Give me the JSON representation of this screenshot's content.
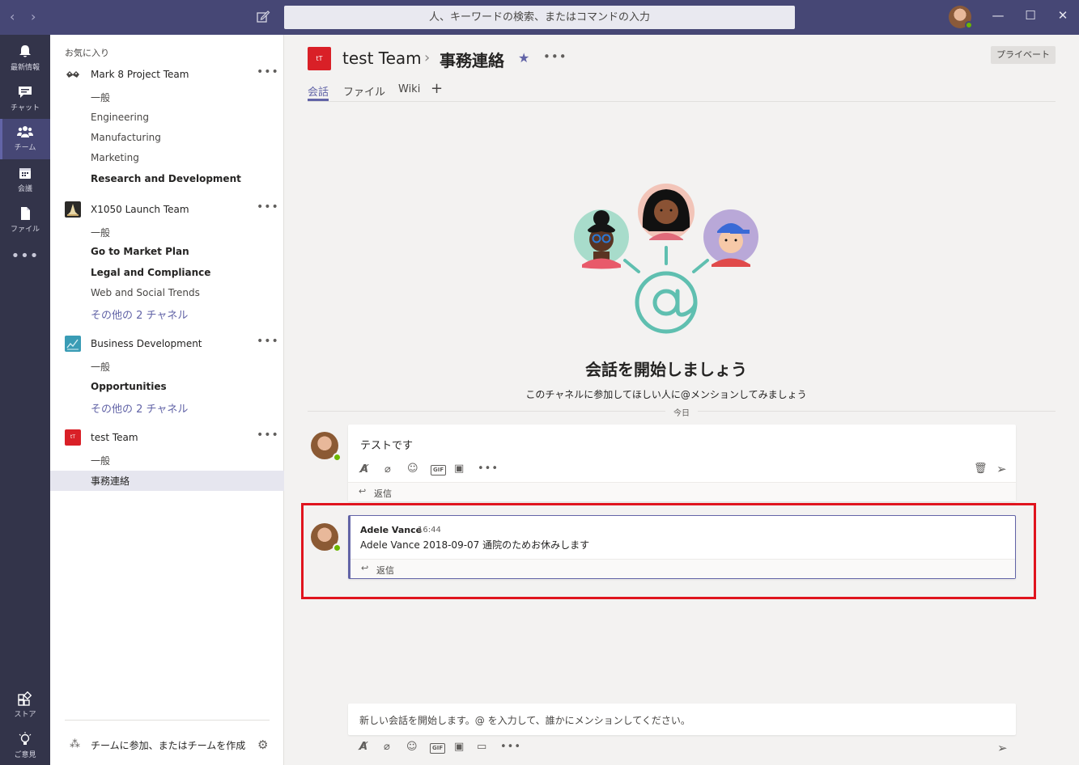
{
  "search": {
    "placeholder": "人、キーワードの検索、またはコマンドの入力"
  },
  "window": {
    "back": "‹",
    "forward": "›",
    "minimize": "—",
    "maximize": "☐",
    "close": "✕"
  },
  "rail": {
    "items": [
      {
        "label": "最新情報",
        "icon": "bell-icon"
      },
      {
        "label": "チャット",
        "icon": "chat-icon"
      },
      {
        "label": "チーム",
        "icon": "teams-icon"
      },
      {
        "label": "会議",
        "icon": "calendar-icon"
      },
      {
        "label": "ファイル",
        "icon": "file-icon"
      }
    ],
    "more": "•••",
    "store": "ストア",
    "feedback": "ご意見"
  },
  "teams_panel": {
    "favorites_label": "お気に入り",
    "teams": [
      {
        "name": "Mark 8 Project Team",
        "icon_text": "",
        "channels": [
          "一般",
          "Engineering",
          "Manufacturing",
          "Marketing",
          "Research and Development"
        ]
      },
      {
        "name": "X1050 Launch Team",
        "icon_text": "",
        "channels": [
          "一般",
          "Go to Market Plan",
          "Legal and Compliance",
          "Web and Social Trends"
        ],
        "more_channels": "その他の 2 チャネル"
      },
      {
        "name": "Business Development",
        "icon_text": "",
        "channels": [
          "一般",
          "Opportunities"
        ],
        "more_channels": "その他の 2 チャネル"
      },
      {
        "name": "test Team",
        "icon_text": "tT",
        "channels": [
          "一般",
          "事務連絡"
        ]
      }
    ],
    "more_glyph": "•••",
    "join_label": "チームに参加、またはチームを作成"
  },
  "channel_header": {
    "team_icon_text": "tT",
    "team_name": "test Team",
    "separator": "›",
    "channel_name": "事務連絡",
    "private_badge": "プライベート",
    "more_glyph": "•••",
    "tabs": [
      "会話",
      "ファイル",
      "Wiki"
    ],
    "add_tab": "+"
  },
  "empty_state": {
    "title": "会話を開始しましょう",
    "subtitle": "このチャネルに参加してほしい人に@メンションしてみましょう"
  },
  "date_divider": "今日",
  "messages": [
    {
      "author": "",
      "time": "",
      "text": "テストです",
      "reply_label": "返信"
    },
    {
      "author": "Adele Vance",
      "time": "16:44",
      "text": "Adele Vance 2018-09-07  通院のためお休みします",
      "reply_label": "返信"
    }
  ],
  "compose": {
    "placeholder": "新しい会話を開始します。@ を入力して、誰かにメンションしてください。",
    "gif_label": "GIF"
  },
  "colors": {
    "titlebar": "#464775",
    "rail": "#33344a",
    "accent": "#6264a7",
    "highlight": "#e0141e",
    "team_icon_red": "#d92027",
    "presence": "#6bb700"
  }
}
